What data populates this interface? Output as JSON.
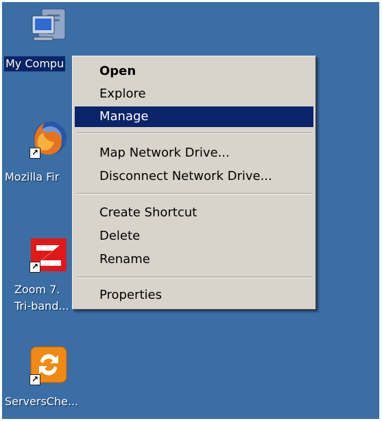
{
  "desktop": {
    "background": "#3a6ea5",
    "icons": [
      {
        "name": "my-computer",
        "label": "My Compu",
        "selected": true,
        "shortcut": false
      },
      {
        "name": "mozilla-firefox",
        "label": "Mozilla Fir",
        "shortcut": true
      },
      {
        "name": "zoom-modem",
        "label_line1": "Zoom 7.",
        "label_line2": "Tri-band...",
        "shortcut": true
      },
      {
        "name": "serverscheck",
        "label": "ServersChe...",
        "shortcut": true
      }
    ]
  },
  "context_menu": {
    "items": [
      {
        "label": "Open",
        "bold": true
      },
      {
        "label": "Explore"
      },
      {
        "label": "Manage",
        "highlighted": true
      },
      {
        "label": "Map Network Drive..."
      },
      {
        "label": "Disconnect Network Drive..."
      },
      {
        "label": "Create Shortcut"
      },
      {
        "label": "Delete"
      },
      {
        "label": "Rename"
      },
      {
        "label": "Properties"
      }
    ],
    "highlight_color": "#0a246a"
  }
}
